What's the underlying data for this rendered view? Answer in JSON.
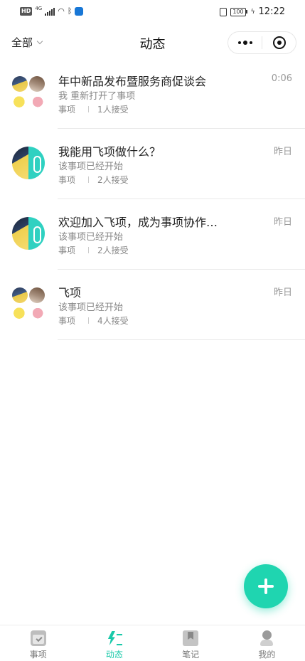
{
  "status_bar": {
    "hd": "HD",
    "network": "4G",
    "battery": "100",
    "time": "12:22",
    "icons": [
      "hd-icon",
      "signal-icon",
      "wifi-icon",
      "bluetooth-icon",
      "app-notification-icon",
      "vibrate-icon",
      "battery-icon"
    ]
  },
  "nav": {
    "filter_label": "全部",
    "title": "动态",
    "capsule_icons": [
      "more-dots-icon",
      "close-target-icon"
    ]
  },
  "feed": {
    "items": [
      {
        "title": "年中新品发布暨服务商促谈会",
        "subtitle": "我 重新打开了事项",
        "type": "事项",
        "accepted": "1人接受",
        "time": "0:06",
        "avatar": "group-avatar"
      },
      {
        "title": "我能用飞项做什么？",
        "subtitle": "该事项已经开始",
        "type": "事项",
        "accepted": "2人接受",
        "time": "昨日",
        "avatar": "pair-avatar"
      },
      {
        "title": "欢迎加入飞项，成为事项协作…",
        "subtitle": "该事项已经开始",
        "type": "事项",
        "accepted": "2人接受",
        "time": "昨日",
        "avatar": "pair-avatar"
      },
      {
        "title": "飞项",
        "subtitle": "该事项已经开始",
        "type": "事项",
        "accepted": "4人接受",
        "time": "昨日",
        "avatar": "group-avatar"
      }
    ]
  },
  "fab": {
    "icon": "plus-icon"
  },
  "tab_bar": {
    "active_color": "#19c9a9",
    "tabs": [
      {
        "label": "事项",
        "icon": "calendar-check-icon"
      },
      {
        "label": "动态",
        "icon": "lightning-icon"
      },
      {
        "label": "笔记",
        "icon": "bookmark-note-icon"
      },
      {
        "label": "我的",
        "icon": "person-icon"
      }
    ]
  }
}
